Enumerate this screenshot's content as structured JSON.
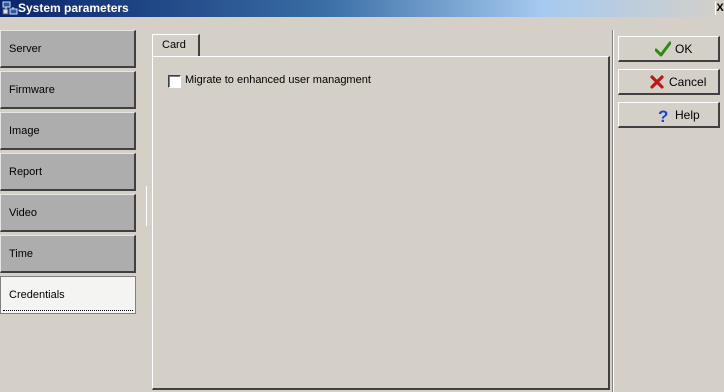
{
  "window": {
    "title": "System parameters",
    "close_label": "X"
  },
  "sidebar": {
    "items": [
      {
        "label": "Server"
      },
      {
        "label": "Firmware"
      },
      {
        "label": "Image"
      },
      {
        "label": "Report"
      },
      {
        "label": "Video"
      },
      {
        "label": "Time"
      },
      {
        "label": "Credentials",
        "active": true
      }
    ]
  },
  "tabs": [
    {
      "label": "Card",
      "selected": true
    }
  ],
  "card": {
    "checkbox_label": "Migrate to enhanced user managment",
    "checked": false
  },
  "buttons": {
    "ok": {
      "label": "OK",
      "icon": "check-icon",
      "color": "#2c8a10"
    },
    "cancel": {
      "label": "Cancel",
      "icon": "x-icon",
      "color": "#c01818"
    },
    "help": {
      "label": "Help",
      "icon": "question-icon",
      "color": "#1848c8"
    }
  }
}
